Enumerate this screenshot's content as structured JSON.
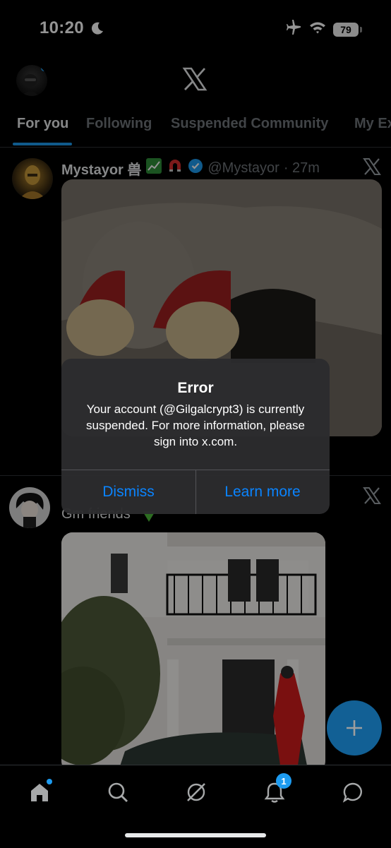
{
  "status_bar": {
    "time": "10:20",
    "battery": "79",
    "icons": [
      "moon-icon",
      "airplane-icon",
      "wifi-icon",
      "battery-icon"
    ]
  },
  "header": {
    "logo": "x-logo"
  },
  "tabs": [
    {
      "label": "For you",
      "active": true
    },
    {
      "label": "Following",
      "active": false
    },
    {
      "label": "Suspended Community",
      "active": false
    },
    {
      "label": "My Ex",
      "active": false
    }
  ],
  "posts": [
    {
      "name": "Mystayor 兽",
      "handle": "@Mystayor",
      "time": "· 27m",
      "badges": [
        "chart-icon",
        "magnet-icon",
        "verified-icon"
      ]
    },
    {
      "text": "Gm friends"
    }
  ],
  "dialog": {
    "title": "Error",
    "message": "Your account (@Gilgalcrypt3) is currently suspended. For more information, please sign into x.com.",
    "dismiss": "Dismiss",
    "learn_more": "Learn more"
  },
  "bottom_nav": {
    "items": [
      "home-icon",
      "search-icon",
      "grok-icon",
      "notifications-icon",
      "messages-icon"
    ],
    "notification_count": "1"
  },
  "colors": {
    "accent": "#1d9bf0",
    "dialog_button": "#0a84ff",
    "background": "#000000"
  }
}
